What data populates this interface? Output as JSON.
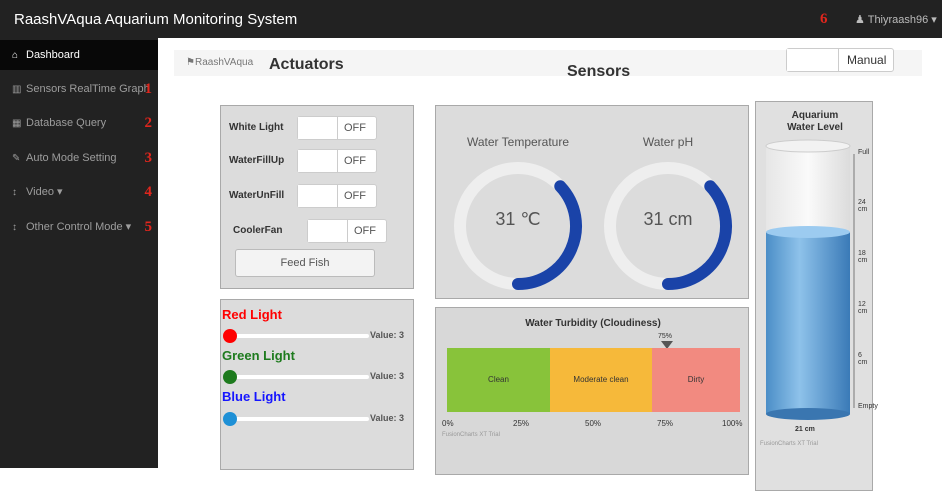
{
  "app": {
    "brand": "RaashVAqua Aquarium Monitoring System",
    "marker": "6",
    "user": "Thiyraash96 ▾"
  },
  "sidebar": {
    "items": [
      {
        "icon": "⌂",
        "label": "Dashboard",
        "num": ""
      },
      {
        "icon": "▥",
        "label": "Sensors RealTime Graph",
        "num": "1"
      },
      {
        "icon": "▦",
        "label": "Database Query",
        "num": "2"
      },
      {
        "icon": "✎",
        "label": "Auto Mode Setting",
        "num": "3"
      },
      {
        "icon": "↕",
        "label": "Video ▾",
        "num": "4"
      },
      {
        "icon": "↕",
        "label": "Other Control Mode ▾",
        "num": "5"
      }
    ]
  },
  "header": {
    "breadcrumb": "RaashVAqua",
    "actuators_title": "Actuators",
    "sensors_title": "Sensors",
    "mode_label": "Manual"
  },
  "actuators": {
    "rows": [
      {
        "label": "White Light",
        "state": "OFF"
      },
      {
        "label": "WaterFillUp",
        "state": "OFF"
      },
      {
        "label": "WaterUnFill",
        "state": "OFF"
      },
      {
        "label": "CoolerFan",
        "state": "OFF"
      }
    ],
    "feed_label": "Feed Fish"
  },
  "sliders": [
    {
      "label": "Red Light",
      "value_text": "Value: 3",
      "color": "#ff0000"
    },
    {
      "label": "Green Light",
      "value_text": "Value: 3",
      "color": "#1e7b1e"
    },
    {
      "label": "Blue Light",
      "value_text": "Value: 3",
      "color": "#1e90d6"
    }
  ],
  "gauges": [
    {
      "title": "Water Temperature",
      "value": "31 ℃",
      "level": 0.37
    },
    {
      "title": "Water pH",
      "value": "31 cm",
      "level": 0.37
    }
  ],
  "turbidity": {
    "title": "Water Turbidity (Cloudiness)",
    "pointer_label": "75%",
    "segments": [
      "Clean",
      "Moderate clean",
      "Dirty"
    ],
    "ticks": [
      "0%",
      "25%",
      "50%",
      "75%",
      "100%"
    ],
    "trial": "FusionCharts XT Trial"
  },
  "water_level": {
    "title_line1": "Aquarium",
    "title_line2": "Water Level",
    "ticks": [
      "Full",
      "24 cm",
      "18 cm",
      "12 cm",
      "6 cm",
      "Empty"
    ],
    "bottom_value": "21 cm",
    "trial": "FusionCharts XT Trial"
  },
  "chart_data": [
    {
      "type": "gauge",
      "title": "Water Temperature",
      "value": "31 ℃"
    },
    {
      "type": "gauge",
      "title": "Water pH",
      "value": "31 cm"
    },
    {
      "type": "linear-gauge",
      "title": "Water Turbidity (Cloudiness)",
      "range": [
        0,
        100
      ],
      "bands": [
        {
          "label": "Clean",
          "from": 0,
          "to": 35,
          "color": "#8cc63f"
        },
        {
          "label": "Moderate clean",
          "from": 35,
          "to": 70,
          "color": "#f7b731"
        },
        {
          "label": "Dirty",
          "from": 70,
          "to": 100,
          "color": "#f2837a"
        }
      ],
      "pointer": 75
    },
    {
      "type": "cylinder",
      "title": "Aquarium Water Level",
      "value": 21,
      "unit": "cm",
      "range": [
        0,
        30
      ]
    }
  ]
}
